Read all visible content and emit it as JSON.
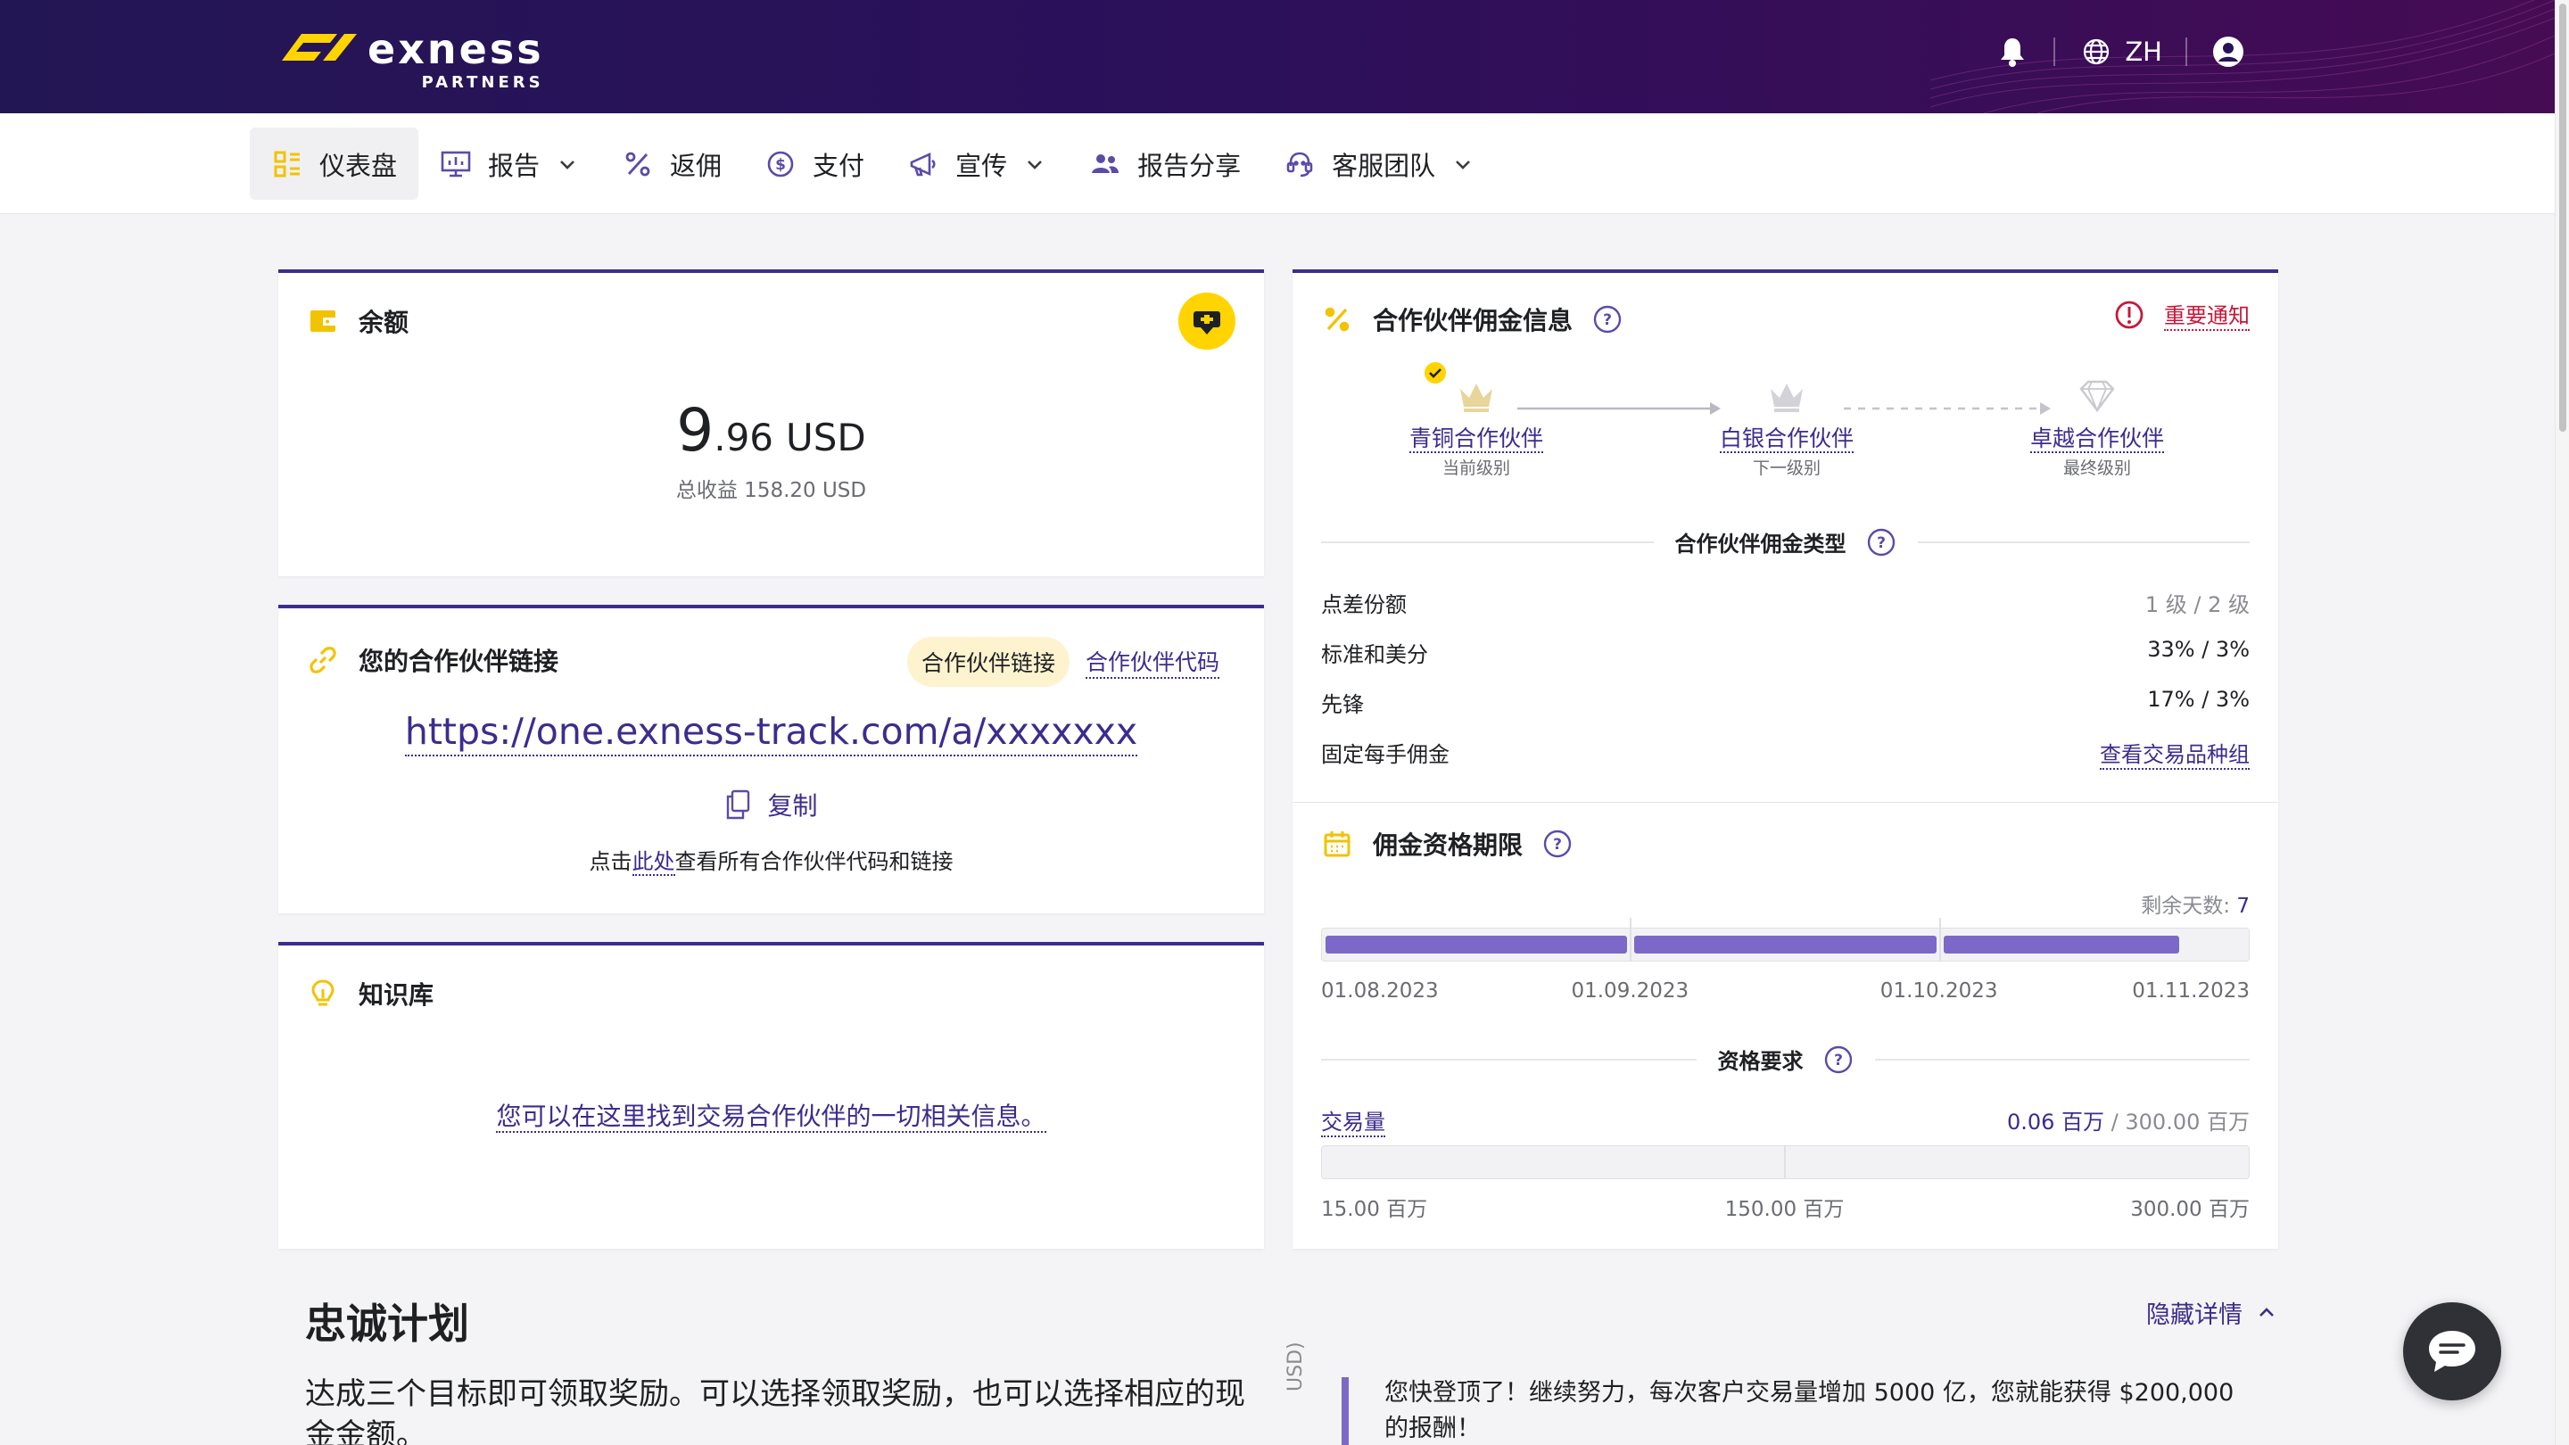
{
  "brand": {
    "name": "exness",
    "sub": "PARTNERS"
  },
  "header": {
    "language": "ZH"
  },
  "nav": {
    "items": [
      {
        "label": "仪表盘"
      },
      {
        "label": "报告"
      },
      {
        "label": "返佣"
      },
      {
        "label": "支付"
      },
      {
        "label": "宣传"
      },
      {
        "label": "报告分享"
      },
      {
        "label": "客服团队"
      }
    ]
  },
  "balance": {
    "title": "余额",
    "int": "9",
    "dec": ".96",
    "currency": "USD",
    "total": "总收益 158.20 USD"
  },
  "partner_link": {
    "title": "您的合作伙伴链接",
    "tab_link": "合作伙伴链接",
    "tab_code": "合作伙伴代码",
    "url": "https://one.exness-track.com/a/xxxxxxx",
    "copy": "复制",
    "hint_before": "点击",
    "hint_link": "此处",
    "hint_after": "查看所有合作伙伴代码和链接"
  },
  "knowledge": {
    "title": "知识库",
    "link": "您可以在这里找到交易合作伙伴的一切相关信息。"
  },
  "commission": {
    "title": "合作伙伴佣金信息",
    "notice": "重要通知",
    "tiers": [
      {
        "name": "青铜合作伙伴",
        "sub": "当前级别"
      },
      {
        "name": "白银合作伙伴",
        "sub": "下一级别"
      },
      {
        "name": "卓越合作伙伴",
        "sub": "最终级别"
      }
    ],
    "types_title": "合作伙伴佣金类型",
    "rows": [
      {
        "k": "点差份额",
        "v": "1 级 / 2 级"
      },
      {
        "k": "标准和美分",
        "v": "33% / 3%"
      },
      {
        "k": "先锋",
        "v": "17% / 3%"
      },
      {
        "k": "固定每手佣金",
        "v": "查看交易品种组"
      }
    ]
  },
  "qualification": {
    "title": "佣金资格期限",
    "days_label": "剩余天数: ",
    "days": "7",
    "progress": [
      1.0,
      1.0,
      0.78
    ],
    "dates": [
      "01.08.2023",
      "01.09.2023",
      "01.10.2023",
      "01.11.2023"
    ],
    "req_title": "资格要求",
    "volume_label": "交易量",
    "volume_current": "0.06 百万",
    "volume_target": " / 300.00 百万",
    "volume_progress": 0.0002,
    "volume_ticks": [
      "15.00 百万",
      "150.00 百万",
      "300.00 百万"
    ]
  },
  "loyalty": {
    "title": "忠诚计划",
    "hide": "隐藏详情",
    "desc": "达成三个目标即可领取奖励。可以选择领取奖励，也可以选择相应的现金金额。",
    "axis": "USD)",
    "message": "您快登顶了！继续努力，每次客户交易量增加 5000 亿，您就能获得 $200,000 的报酬！"
  },
  "colors": {
    "accent": "#3d2c8d",
    "brand_yellow": "#ffd400",
    "alert": "#c7183a",
    "progress": "#7c68c7"
  }
}
